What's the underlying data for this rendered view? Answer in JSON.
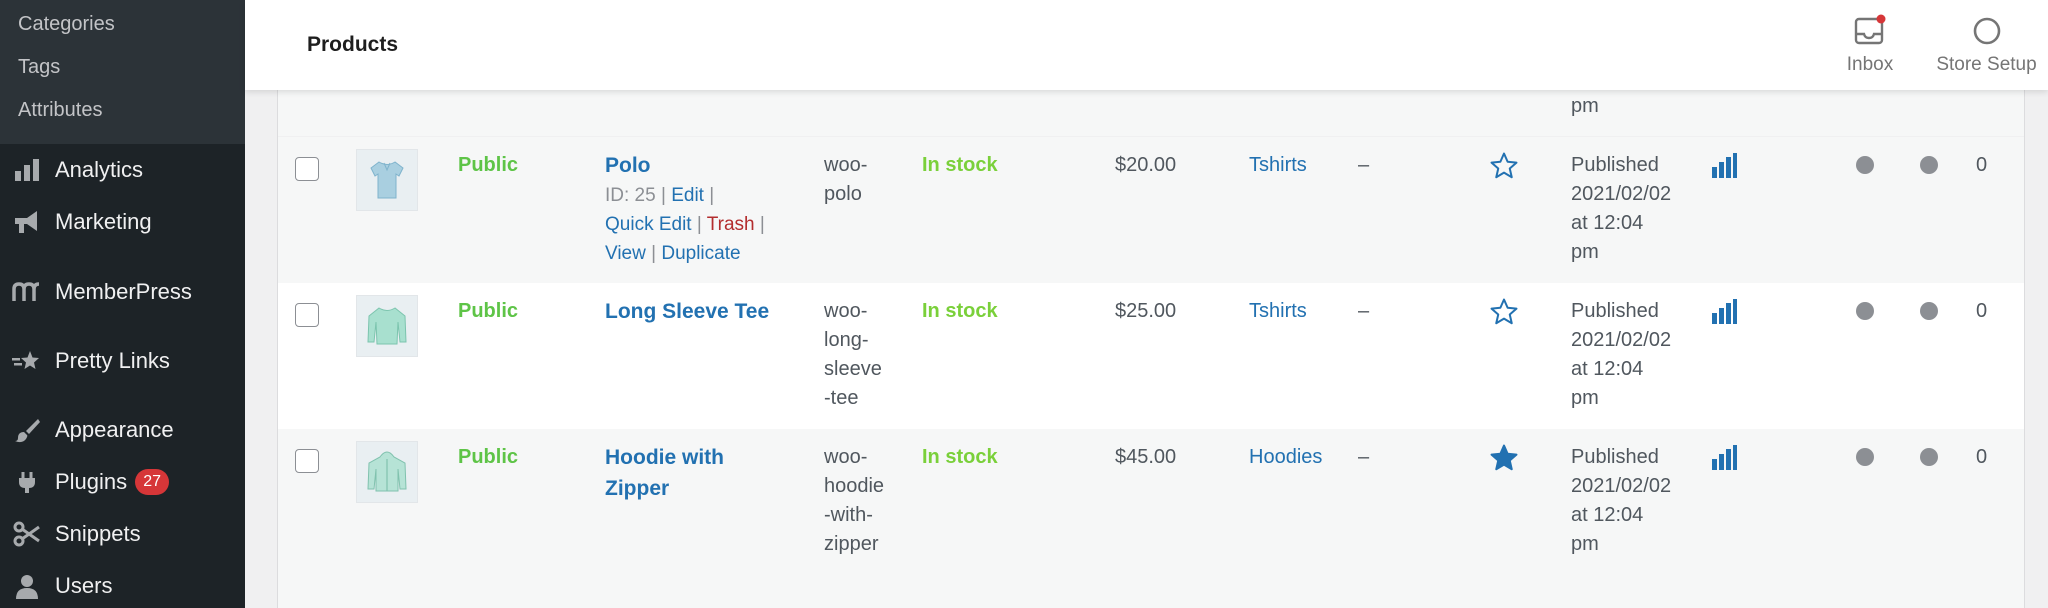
{
  "sidebar": {
    "submenu": [
      {
        "label": "Categories"
      },
      {
        "label": "Tags"
      },
      {
        "label": "Attributes"
      }
    ],
    "menu": [
      {
        "label": "Analytics",
        "icon": "bar-chart-icon"
      },
      {
        "label": "Marketing",
        "icon": "megaphone-icon"
      },
      {
        "label": "MemberPress",
        "icon": "memberpress-icon"
      },
      {
        "label": "Pretty Links",
        "icon": "star-link-icon"
      },
      {
        "label": "Appearance",
        "icon": "paintbrush-icon"
      },
      {
        "label": "Plugins",
        "icon": "plug-icon",
        "badge": "27"
      },
      {
        "label": "Snippets",
        "icon": "scissors-icon"
      },
      {
        "label": "Users",
        "icon": "user-icon"
      }
    ]
  },
  "header": {
    "title": "Products",
    "inbox_label": "Inbox",
    "store_setup_label": "Store Setup"
  },
  "table": {
    "prev_row_tail": "pm",
    "rows": [
      {
        "status": "Public",
        "name": "Polo",
        "actions": {
          "id": "ID: 25",
          "edit": "Edit",
          "quick_edit": "Quick Edit",
          "trash": "Trash",
          "view": "View",
          "duplicate": "Duplicate"
        },
        "sku": [
          "woo-",
          "polo"
        ],
        "stock": "In stock",
        "price": "$20.00",
        "category": "Tshirts",
        "tags": "–",
        "featured": false,
        "date": [
          "Published",
          "2021/02/02",
          "at 12:04",
          "pm"
        ],
        "count": "0"
      },
      {
        "status": "Public",
        "name": "Long Sleeve Tee",
        "sku": [
          "woo-",
          "long-",
          "sleeve",
          "-tee"
        ],
        "stock": "In stock",
        "price": "$25.00",
        "category": "Tshirts",
        "tags": "–",
        "featured": false,
        "date": [
          "Published",
          "2021/02/02",
          "at 12:04",
          "pm"
        ],
        "count": "0"
      },
      {
        "status": "Public",
        "name_lines": [
          "Hoodie with",
          "Zipper"
        ],
        "sku": [
          "woo-",
          "hoodie",
          "-with-",
          "zipper"
        ],
        "stock": "In stock",
        "price": "$45.00",
        "category": "Hoodies",
        "tags": "–",
        "featured": true,
        "date": [
          "Published",
          "2021/02/02",
          "at 12:04",
          "pm"
        ],
        "count": "0"
      }
    ]
  },
  "colors": {
    "sidebar_bg": "#1d2327",
    "submenu_bg": "#2c3338",
    "link": "#2271b1",
    "public_green": "#5ec447",
    "stock_green": "#7ad03a",
    "trash_red": "#b32d2e",
    "badge_red": "#d63638"
  }
}
